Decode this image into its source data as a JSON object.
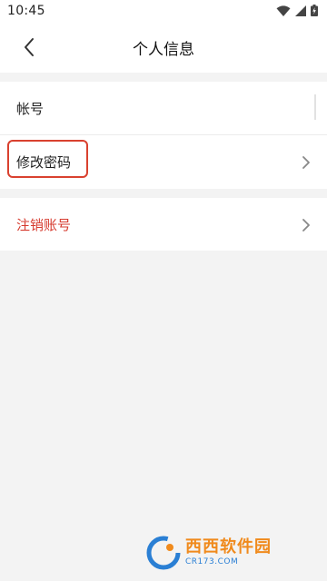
{
  "status_bar": {
    "time": "10:45"
  },
  "header": {
    "title": "个人信息"
  },
  "rows": {
    "account": {
      "label": "帐号"
    },
    "change_password": {
      "label": "修改密码"
    },
    "cancel_account": {
      "label": "注销账号"
    }
  },
  "watermark": {
    "main": "西西软件园",
    "sub": "CR173.COM"
  },
  "colors": {
    "danger_text": "#d63b2f",
    "highlight_border": "#d9412f",
    "background": "#f3f3f3"
  }
}
